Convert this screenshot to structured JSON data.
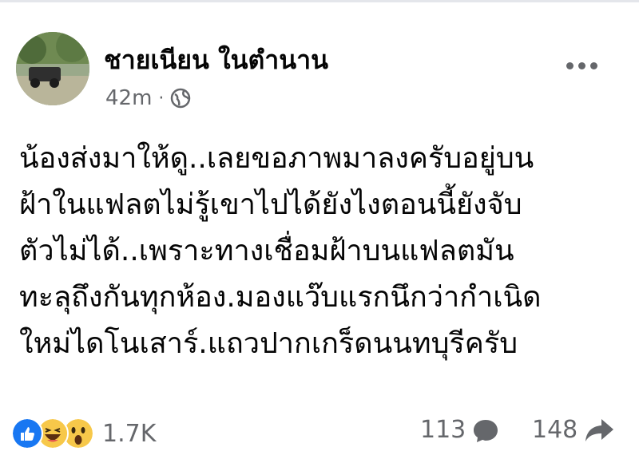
{
  "post": {
    "author": "ชายเนียน ในตำนาน",
    "time": "42m",
    "separator": "·",
    "audience_icon": "globe-icon",
    "more_icon": "more-horizontal-icon",
    "text_lines": [
      "น้องส่งมาให้ดู..เลยขอภาพมาลงครับอยู่บน",
      "ฝ้าในแฟลตไม่รู้เขาไปได้ยังไงตอนนี้ยังจับ",
      "ตัวไม่ได้..เพราะทางเชื่อมฝ้าบนแฟลตมัน",
      "ทะลุถึงกันทุกห้อง.มองแว๊บแรกนึกว่ากำเนิด",
      "ใหม่ไดโนเสาร์.แถวปากเกร็ดนนทบุรีครับ"
    ]
  },
  "footer": {
    "reactions": [
      "like-icon",
      "haha-icon",
      "wow-icon"
    ],
    "reaction_count": "1.7K",
    "comment_count": "113",
    "comment_icon": "comment-bubble-icon",
    "share_count": "148",
    "share_icon": "share-arrow-icon"
  },
  "colors": {
    "text": "#050505",
    "secondary": "#65676b",
    "like_blue": "#1877f2",
    "emoji_yellow": "#f7c84a"
  }
}
